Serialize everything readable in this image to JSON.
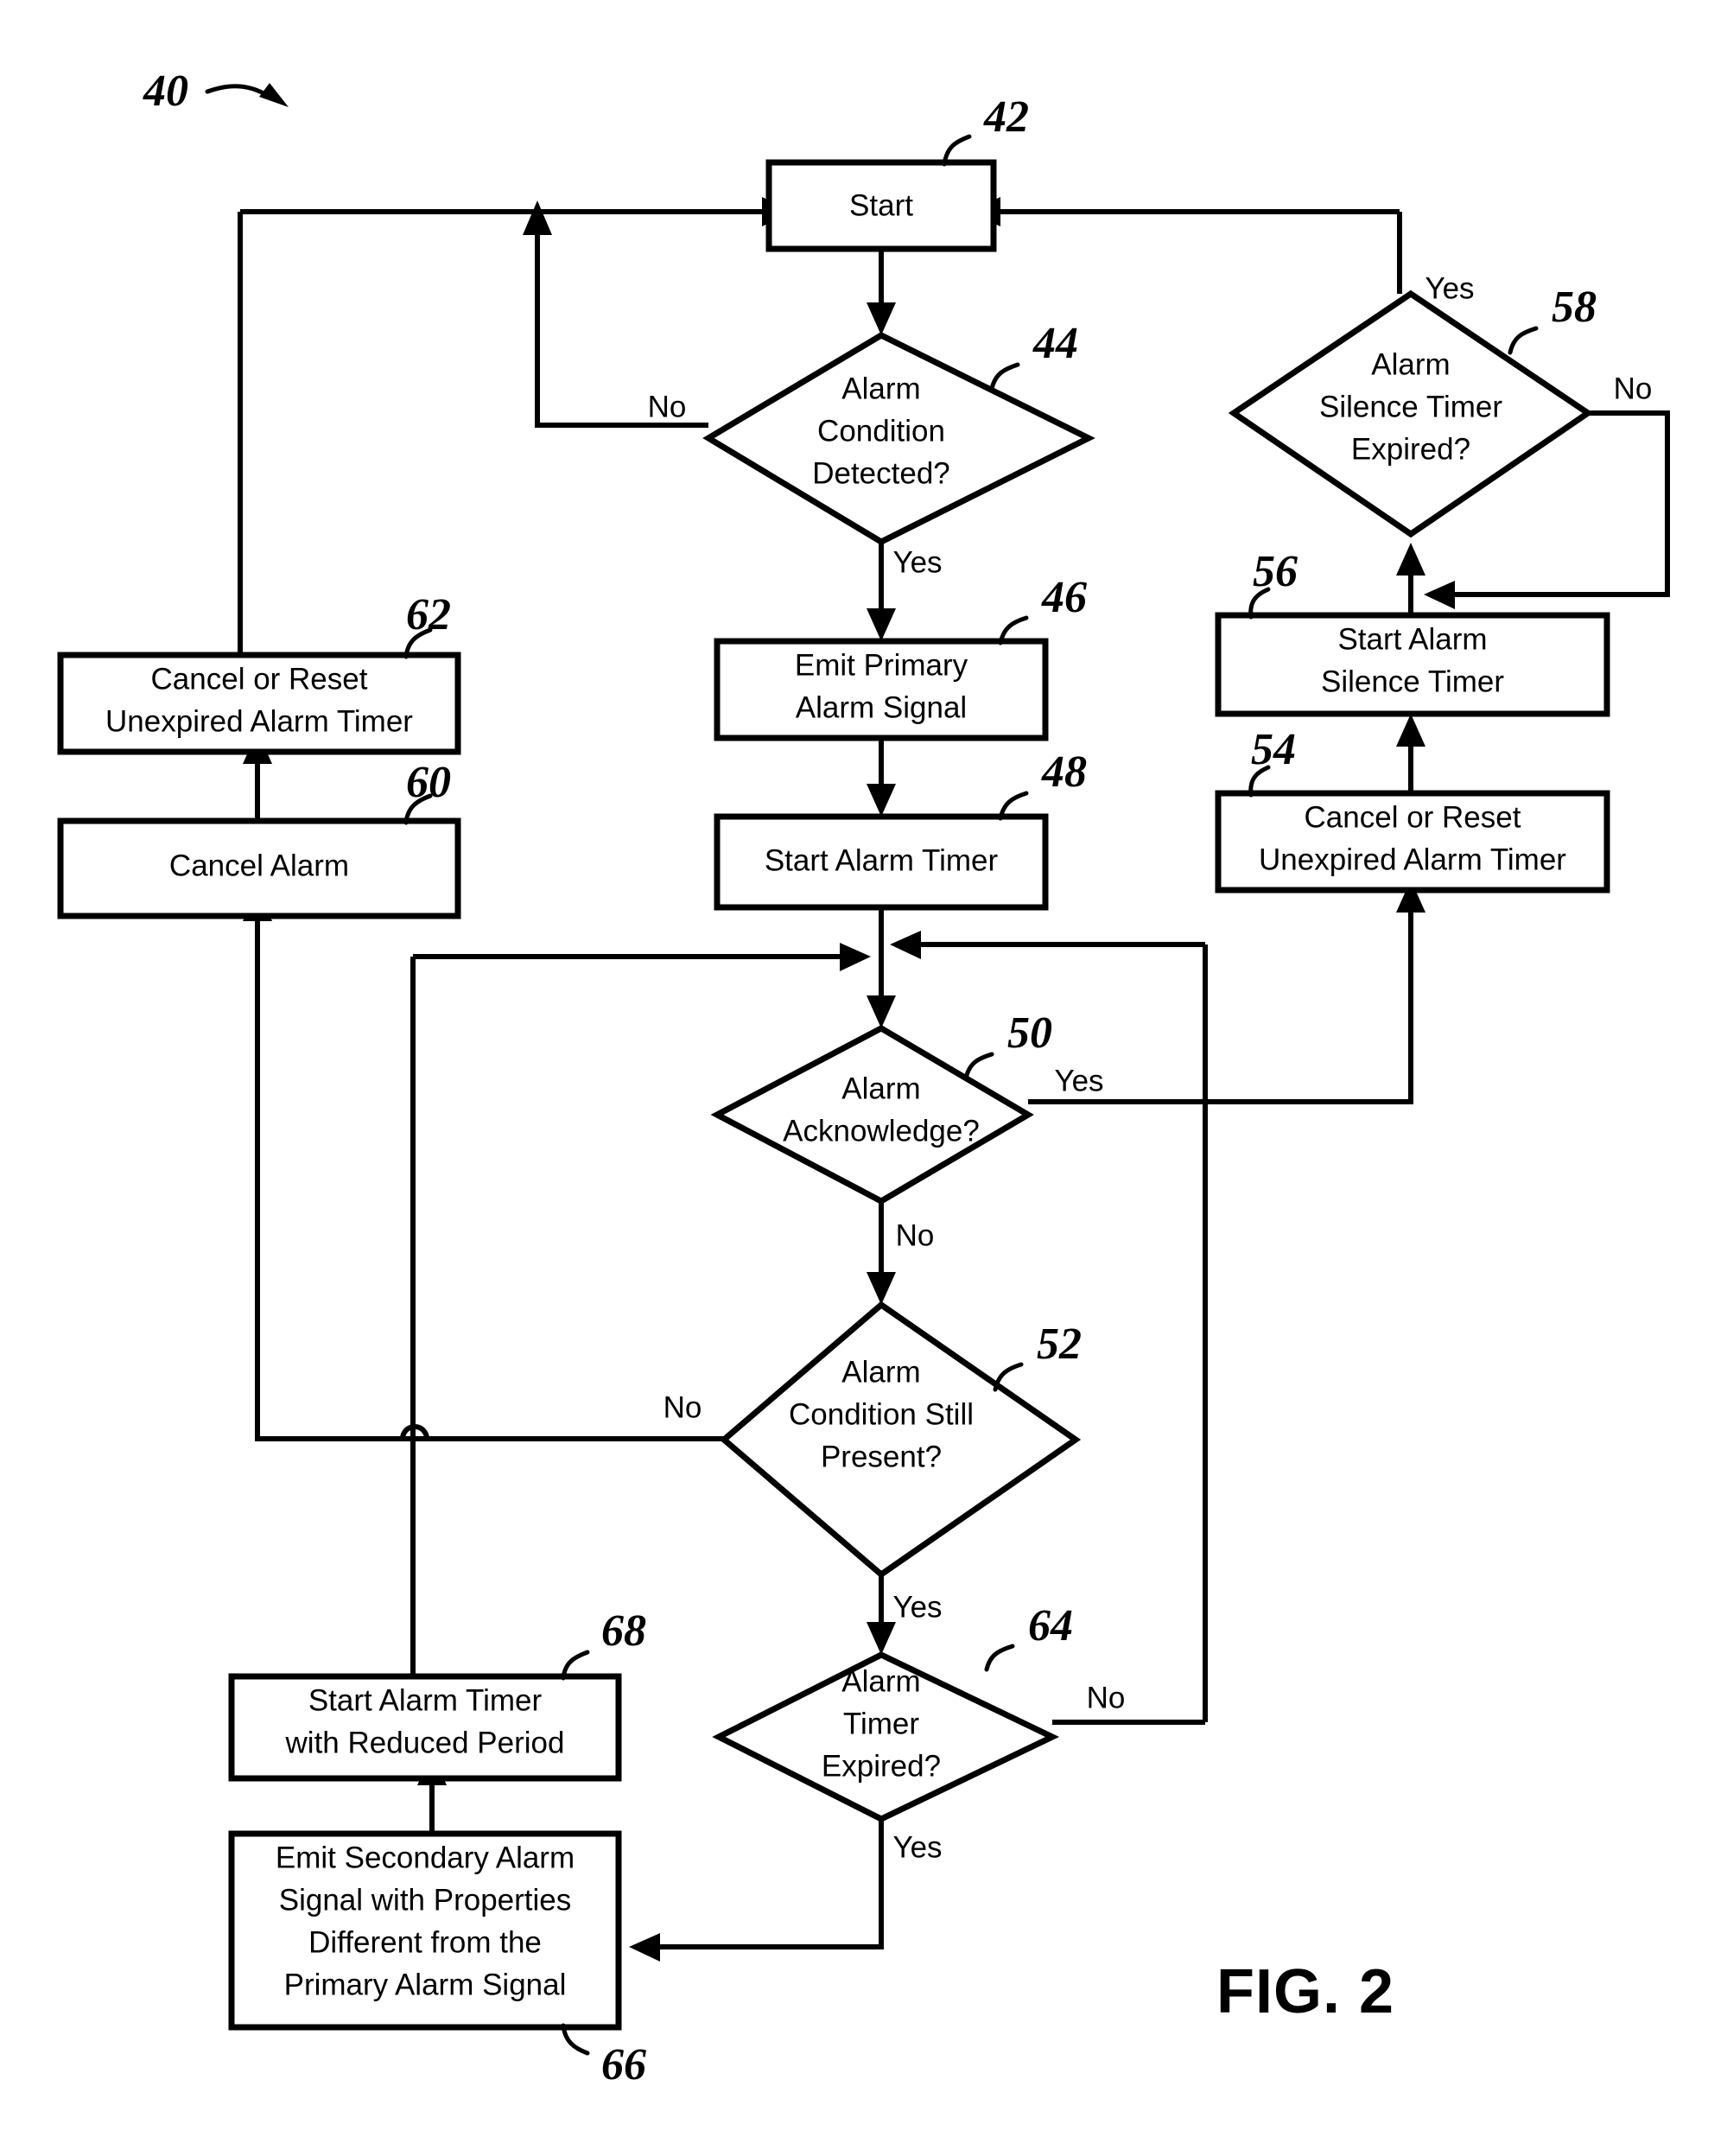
{
  "figure": {
    "caption": "FIG. 2",
    "diagram_ref": "40"
  },
  "chart_data": {
    "type": "diagram",
    "title": "FIG. 2",
    "subtype": "flowchart",
    "nodes": [
      {
        "ref": "42",
        "shape": "process",
        "lines": [
          "Start"
        ]
      },
      {
        "ref": "44",
        "shape": "decision",
        "lines": [
          "Alarm",
          "Condition",
          "Detected?"
        ]
      },
      {
        "ref": "46",
        "shape": "process",
        "lines": [
          "Emit Primary",
          "Alarm Signal"
        ]
      },
      {
        "ref": "48",
        "shape": "process",
        "lines": [
          "Start Alarm Timer"
        ]
      },
      {
        "ref": "50",
        "shape": "decision",
        "lines": [
          "Alarm",
          "Acknowledge?"
        ]
      },
      {
        "ref": "52",
        "shape": "decision",
        "lines": [
          "Alarm",
          "Condition Still",
          "Present?"
        ]
      },
      {
        "ref": "54",
        "shape": "process",
        "lines": [
          "Cancel or Reset",
          "Unexpired Alarm Timer"
        ]
      },
      {
        "ref": "56",
        "shape": "process",
        "lines": [
          "Start Alarm",
          "Silence Timer"
        ]
      },
      {
        "ref": "58",
        "shape": "decision",
        "lines": [
          "Alarm",
          "Silence Timer",
          "Expired?"
        ]
      },
      {
        "ref": "60",
        "shape": "process",
        "lines": [
          "Cancel Alarm"
        ]
      },
      {
        "ref": "62",
        "shape": "process",
        "lines": [
          "Cancel or Reset",
          "Unexpired Alarm Timer"
        ]
      },
      {
        "ref": "64",
        "shape": "decision",
        "lines": [
          "Alarm",
          "Timer",
          "Expired?"
        ]
      },
      {
        "ref": "66",
        "shape": "process",
        "lines": [
          "Emit Secondary Alarm",
          "Signal with Properties",
          "Different from the",
          "Primary Alarm Signal"
        ]
      },
      {
        "ref": "68",
        "shape": "process",
        "lines": [
          "Start Alarm Timer",
          "with Reduced Period"
        ]
      }
    ],
    "edges": [
      {
        "from": "42",
        "to": "44",
        "label": ""
      },
      {
        "from": "44",
        "to": "42",
        "label": "No"
      },
      {
        "from": "44",
        "to": "46",
        "label": "Yes"
      },
      {
        "from": "46",
        "to": "48",
        "label": ""
      },
      {
        "from": "48",
        "to": "50",
        "label": ""
      },
      {
        "from": "50",
        "to": "54",
        "label": "Yes"
      },
      {
        "from": "50",
        "to": "52",
        "label": "No"
      },
      {
        "from": "52",
        "to": "60",
        "label": "No"
      },
      {
        "from": "52",
        "to": "64",
        "label": "Yes"
      },
      {
        "from": "54",
        "to": "56",
        "label": ""
      },
      {
        "from": "56",
        "to": "58",
        "label": ""
      },
      {
        "from": "58",
        "to": "42",
        "label": "Yes"
      },
      {
        "from": "58",
        "to": "56",
        "label": "No"
      },
      {
        "from": "60",
        "to": "62",
        "label": ""
      },
      {
        "from": "62",
        "to": "42",
        "label": ""
      },
      {
        "from": "64",
        "to": "50",
        "label": "No"
      },
      {
        "from": "64",
        "to": "66",
        "label": "Yes"
      },
      {
        "from": "66",
        "to": "68",
        "label": ""
      },
      {
        "from": "68",
        "to": "50",
        "label": ""
      }
    ]
  },
  "nodes": {
    "n42": {
      "ref": "42",
      "l1": "Start"
    },
    "n44": {
      "ref": "44",
      "l1": "Alarm",
      "l2": "Condition",
      "l3": "Detected?"
    },
    "n46": {
      "ref": "46",
      "l1": "Emit Primary",
      "l2": "Alarm Signal"
    },
    "n48": {
      "ref": "48",
      "l1": "Start Alarm Timer"
    },
    "n50": {
      "ref": "50",
      "l1": "Alarm",
      "l2": "Acknowledge?"
    },
    "n52": {
      "ref": "52",
      "l1": "Alarm",
      "l2": "Condition Still",
      "l3": "Present?"
    },
    "n54": {
      "ref": "54",
      "l1": "Cancel or Reset",
      "l2": "Unexpired Alarm Timer"
    },
    "n56": {
      "ref": "56",
      "l1": "Start Alarm",
      "l2": "Silence Timer"
    },
    "n58": {
      "ref": "58",
      "l1": "Alarm",
      "l2": "Silence Timer",
      "l3": "Expired?"
    },
    "n60": {
      "ref": "60",
      "l1": "Cancel Alarm"
    },
    "n62": {
      "ref": "62",
      "l1": "Cancel or Reset",
      "l2": "Unexpired Alarm Timer"
    },
    "n64": {
      "ref": "64",
      "l1": "Alarm",
      "l2": "Timer",
      "l3": "Expired?"
    },
    "n66": {
      "ref": "66",
      "l1": "Emit Secondary Alarm",
      "l2": "Signal with Properties",
      "l3": "Different from the",
      "l4": "Primary Alarm Signal"
    },
    "n68": {
      "ref": "68",
      "l1": "Start Alarm Timer",
      "l2": "with Reduced Period"
    }
  },
  "branch_labels": {
    "no_44": "No",
    "yes_44": "Yes",
    "yes_50": "Yes",
    "no_50": "No",
    "no_52": "No",
    "yes_52": "Yes",
    "yes_58": "Yes",
    "no_58": "No",
    "no_64": "No",
    "yes_64": "Yes"
  },
  "colors": {
    "ink": "#000000",
    "paper": "#ffffff"
  }
}
